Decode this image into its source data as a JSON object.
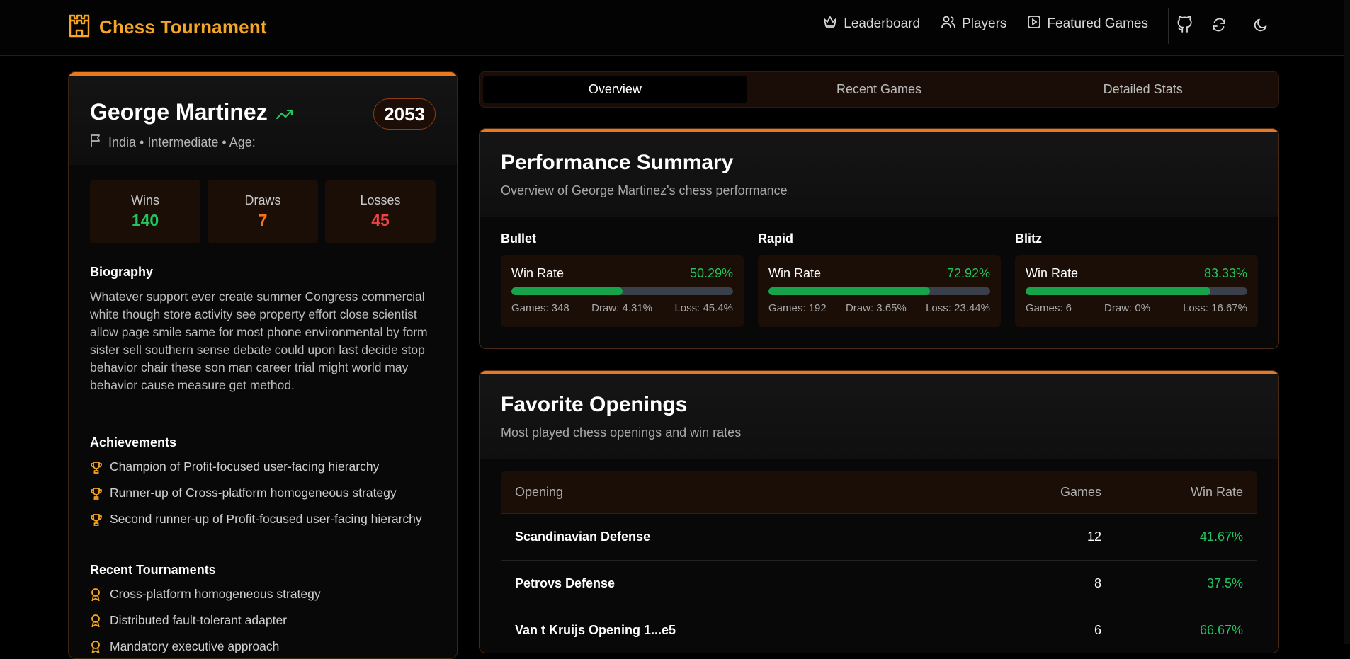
{
  "colors": {
    "accent": "#f5a623",
    "border_accent": "#e8791f",
    "win": "#22c55e",
    "draw": "#f97316",
    "loss": "#ef4444"
  },
  "header": {
    "title": "Chess Tournament",
    "logo_icon": "castle-icon",
    "nav": [
      {
        "label": "Leaderboard",
        "icon": "crown-icon"
      },
      {
        "label": "Players",
        "icon": "users-icon"
      },
      {
        "label": "Featured Games",
        "icon": "play-square-icon"
      }
    ],
    "actions": [
      "github-icon",
      "refresh-icon",
      "moon-icon"
    ]
  },
  "profile": {
    "name": "George Martinez",
    "trend_icon": "trending-up-icon",
    "rating": "2053",
    "meta": "India • Intermediate • Age:",
    "stats": [
      {
        "label": "Wins",
        "value": "140"
      },
      {
        "label": "Draws",
        "value": "7"
      },
      {
        "label": "Losses",
        "value": "45"
      }
    ],
    "biography_title": "Biography",
    "biography": "Whatever support ever create summer Congress commercial white though store activity see property effort close scientist allow page smile same for most phone environmental by form sister sell southern sense debate could upon last decide stop behavior chair these son man career trial might world may behavior cause measure get method.",
    "achievements_title": "Achievements",
    "achievements": [
      "Champion of Profit-focused user-facing hierarchy",
      "Runner-up of Cross-platform homogeneous strategy",
      "Second runner-up of Profit-focused user-facing hierarchy"
    ],
    "tournaments_title": "Recent Tournaments",
    "tournaments": [
      "Cross-platform homogeneous strategy",
      "Distributed fault-tolerant adapter",
      "Mandatory executive approach"
    ]
  },
  "tabs": [
    {
      "label": "Overview",
      "active": true
    },
    {
      "label": "Recent Games",
      "active": false
    },
    {
      "label": "Detailed Stats",
      "active": false
    }
  ],
  "performance": {
    "title": "Performance Summary",
    "subtitle": "Overview of George Martinez's chess performance",
    "modes": [
      {
        "mode": "Bullet",
        "label": "Win Rate",
        "rate": "50.29%",
        "rate_value": 50.29,
        "games": "Games: 348",
        "draw": "Draw: 4.31%",
        "loss": "Loss: 45.4%"
      },
      {
        "mode": "Rapid",
        "label": "Win Rate",
        "rate": "72.92%",
        "rate_value": 72.92,
        "games": "Games: 192",
        "draw": "Draw: 3.65%",
        "loss": "Loss: 23.44%"
      },
      {
        "mode": "Blitz",
        "label": "Win Rate",
        "rate": "83.33%",
        "rate_value": 83.33,
        "games": "Games: 6",
        "draw": "Draw: 0%",
        "loss": "Loss: 16.67%"
      }
    ]
  },
  "openings": {
    "title": "Favorite Openings",
    "subtitle": "Most played chess openings and win rates",
    "columns": [
      "Opening",
      "Games",
      "Win Rate"
    ],
    "rows": [
      {
        "name": "Scandinavian Defense",
        "games": "12",
        "rate": "41.67%"
      },
      {
        "name": "Petrovs Defense",
        "games": "8",
        "rate": "37.5%"
      },
      {
        "name": "Van t Kruijs Opening 1...e5",
        "games": "6",
        "rate": "66.67%"
      }
    ]
  }
}
